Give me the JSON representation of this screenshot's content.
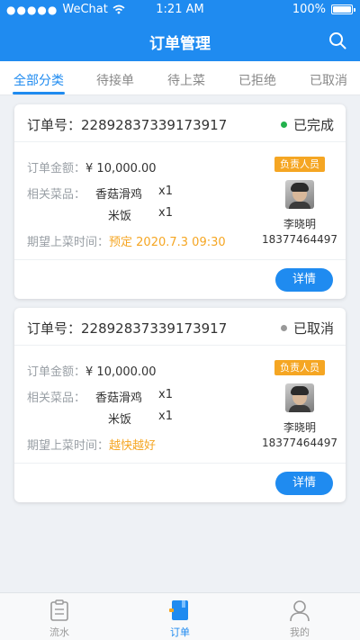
{
  "status_bar": {
    "carrier": "WeChat",
    "time": "1:21 AM",
    "battery": "100%"
  },
  "header": {
    "title": "订单管理",
    "search_icon": "search-icon",
    "color": "#1f8bf0"
  },
  "tabs": [
    {
      "label": "全部分类",
      "active": true
    },
    {
      "label": "待接单",
      "active": false
    },
    {
      "label": "待上菜",
      "active": false
    },
    {
      "label": "已拒绝",
      "active": false
    },
    {
      "label": "已取消",
      "active": false
    }
  ],
  "orders": [
    {
      "order_label": "订单号：22892837339173917",
      "status": "已完成",
      "status_color": "#22b14c",
      "amount_label": "订单金额：",
      "amount_value": "¥ 10,000.00",
      "dishes_label": "相关菜品：",
      "dishes": [
        {
          "name": "香菇滑鸡",
          "qty": "x1"
        },
        {
          "name": "米饭",
          "qty": "x1"
        }
      ],
      "time_label": "期望上菜时间：",
      "time_value": "预定 2020.7.3  09:30",
      "person_tag": "负责人员",
      "person_name": "李晓明",
      "person_phone": "18377464497",
      "detail_button": "详情"
    },
    {
      "order_label": "订单号：22892837339173917",
      "status": "已取消",
      "status_color": "#999999",
      "amount_label": "订单金额：",
      "amount_value": "¥ 10,000.00",
      "dishes_label": "相关菜品：",
      "dishes": [
        {
          "name": "香菇滑鸡",
          "qty": "x1"
        },
        {
          "name": "米饭",
          "qty": "x1"
        }
      ],
      "time_label": "期望上菜时间：",
      "time_value": "越快越好",
      "person_tag": "负责人员",
      "person_name": "李晓明",
      "person_phone": "18377464497",
      "detail_button": "详情"
    }
  ],
  "tabbar": [
    {
      "label": "流水",
      "icon": "ledger-icon",
      "active": false
    },
    {
      "label": "订单",
      "icon": "order-icon",
      "active": true
    },
    {
      "label": "我的",
      "icon": "user-icon",
      "active": false
    }
  ]
}
